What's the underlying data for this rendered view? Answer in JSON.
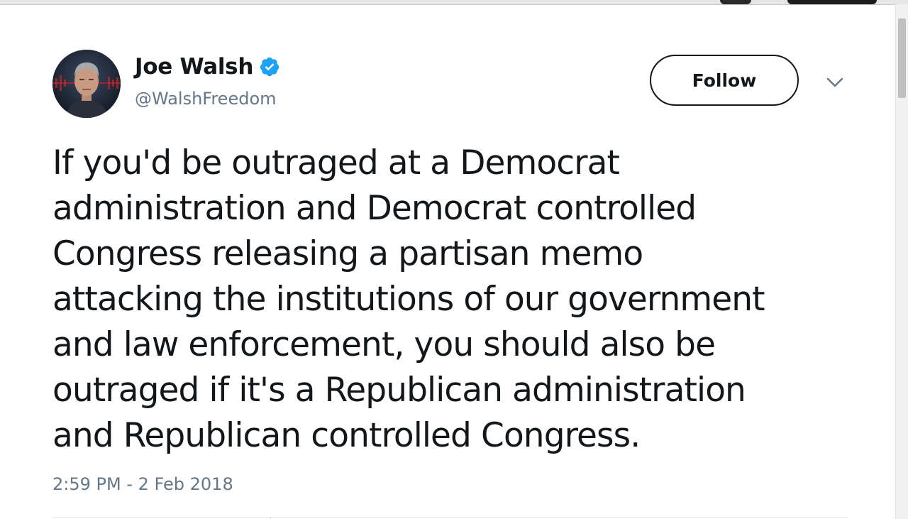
{
  "tweet": {
    "author": {
      "display_name": "Joe Walsh",
      "handle": "@WalshFreedom",
      "verified": true,
      "avatar_icon": "avatar-photo"
    },
    "follow_label": "Follow",
    "menu_icon": "chevron-down-icon",
    "text_lines": [
      "If you'd be outraged at a Democrat",
      "administration and Democrat controlled",
      "Congress releasing a partisan memo",
      "attacking the institutions of our government",
      "and law enforcement, you should also be",
      "outraged if it's a Republican administration",
      "and Republican controlled Congress."
    ],
    "timestamp": "2:59 PM - 2 Feb 2018"
  },
  "colors": {
    "text_primary": "#14171a",
    "text_secondary": "#657786",
    "verified_blue": "#1da1f2",
    "divider": "#e1e8ed"
  }
}
